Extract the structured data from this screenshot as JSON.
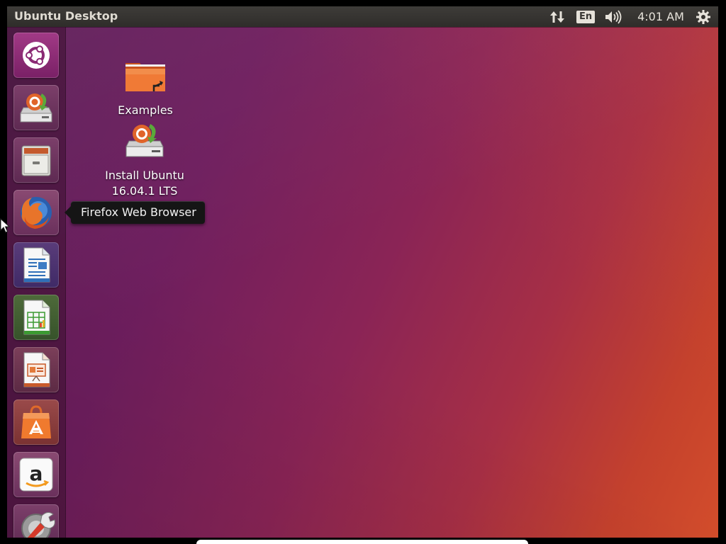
{
  "topbar": {
    "title": "Ubuntu Desktop",
    "language": "En",
    "clock": "4:01 AM",
    "icons": [
      "network-icon",
      "sound-icon",
      "power-settings-icon"
    ]
  },
  "launcher": {
    "items": [
      {
        "name": "dash-home",
        "icon": "ubuntu-logo-icon"
      },
      {
        "name": "install-ubuntu",
        "icon": "installer-icon"
      },
      {
        "name": "files",
        "icon": "file-cabinet-icon"
      },
      {
        "name": "firefox",
        "icon": "firefox-icon"
      },
      {
        "name": "libreoffice-writer",
        "icon": "writer-icon"
      },
      {
        "name": "libreoffice-calc",
        "icon": "calc-icon"
      },
      {
        "name": "libreoffice-impress",
        "icon": "impress-icon"
      },
      {
        "name": "ubuntu-software",
        "icon": "software-center-icon"
      },
      {
        "name": "amazon",
        "icon": "amazon-icon"
      },
      {
        "name": "system-settings",
        "icon": "settings-wrench-icon"
      }
    ]
  },
  "desktop": {
    "icons": [
      {
        "label": "Examples",
        "icon": "folder-link-icon"
      },
      {
        "label": "Install Ubuntu 16.04.1 LTS",
        "line1": "Install Ubuntu",
        "line2": "16.04.1 LTS",
        "icon": "installer-icon"
      }
    ]
  },
  "tooltip": {
    "text": "Firefox Web Browser"
  },
  "colors": {
    "wallpaper_start": "#5c1d58",
    "wallpaper_end": "#d34d2b",
    "panel": "#353330",
    "tooltip": "#151515"
  }
}
